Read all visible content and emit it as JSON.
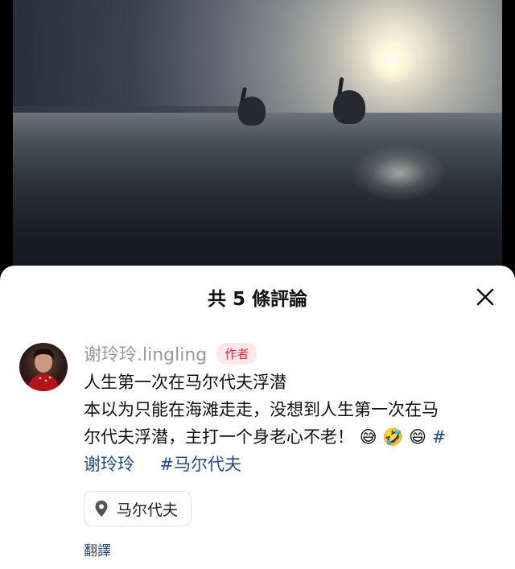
{
  "sheet": {
    "title": "共 5 條評論"
  },
  "comment": {
    "username": "谢玲玲.lingling",
    "badge": "作者",
    "title_line": "人生第一次在马尔代夫浮潜",
    "line2": "本以为只能在海滩走走，没想到人生第一次在马",
    "line3_text": "尔代夫浮潜，主打一个身老心不老！",
    "emojis": [
      "😅",
      "🤣",
      "😄"
    ],
    "line3_hash": "#",
    "line4_tag1": "谢玲玲",
    "line4_tag2": "#马尔代夫",
    "location": "马尔代夫",
    "translate": "翻譯"
  },
  "icons": {
    "close": "close-icon",
    "location": "location-pin-icon"
  },
  "colors": {
    "badge_text": "#e0334a",
    "badge_bg": "#fde8ea",
    "hashtag": "#1d4d8c",
    "translate": "#2e4a6e"
  }
}
